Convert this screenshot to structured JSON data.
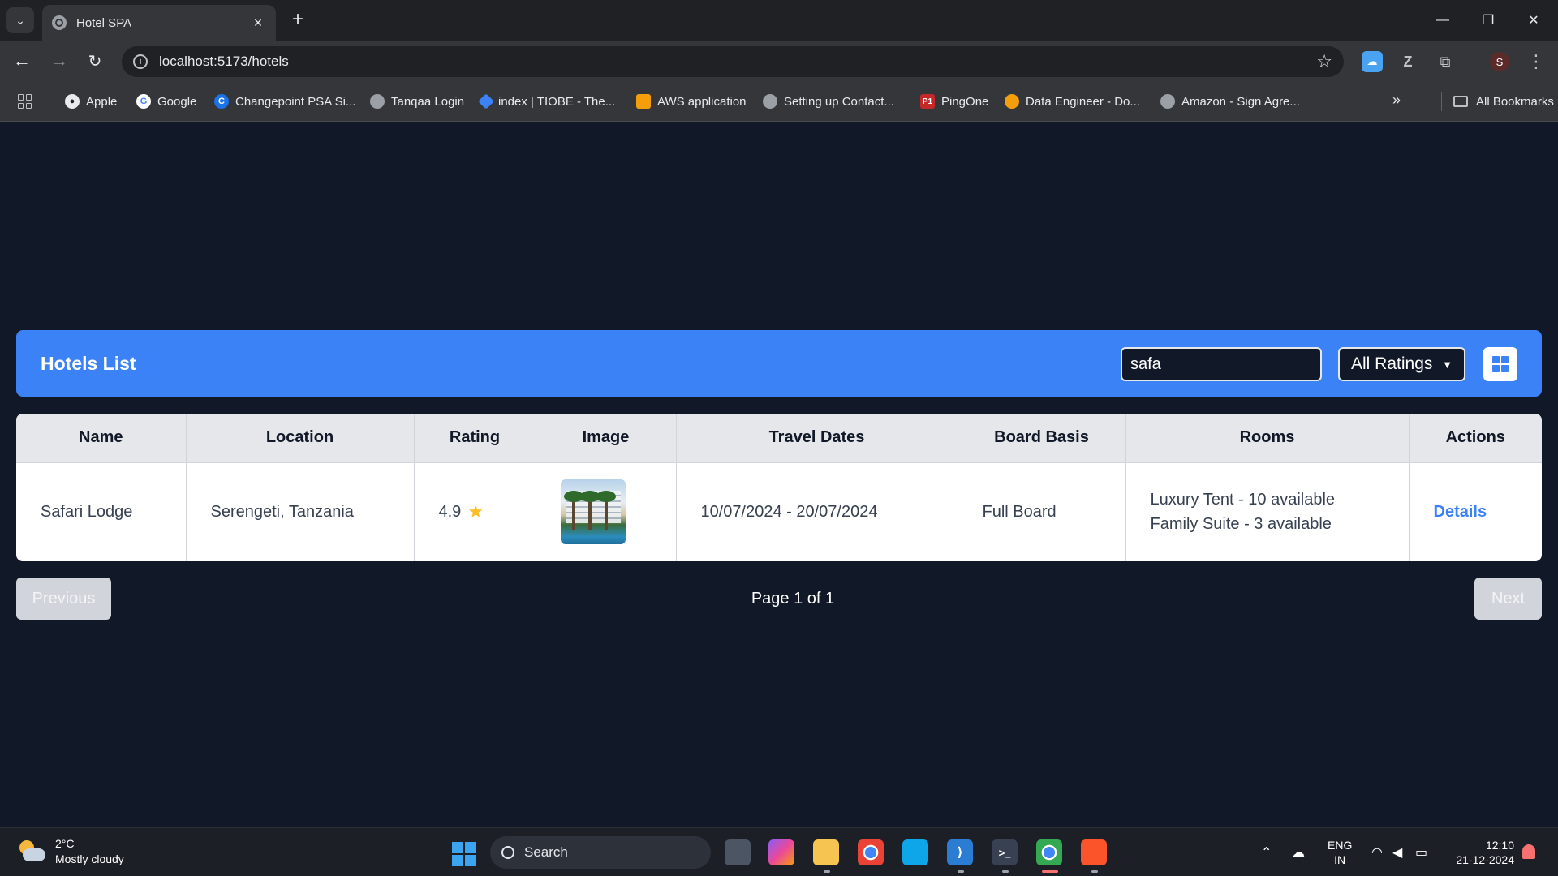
{
  "browser": {
    "tab_title": "Hotel SPA",
    "url": "localhost:5173/hotels",
    "profile_initial": "S",
    "bookmarks": [
      {
        "label": "Apple",
        "color": "#e8eaed"
      },
      {
        "label": "Google",
        "color": "#4285f4"
      },
      {
        "label": "Changepoint PSA Si...",
        "color": "#1a73e8"
      },
      {
        "label": "Tanqaa Login",
        "color": "#9aa0a6"
      },
      {
        "label": "index | TIOBE - The...",
        "color": "#3b82f6"
      },
      {
        "label": "AWS application",
        "color": "#f59e0b"
      },
      {
        "label": "Setting up Contact...",
        "color": "#9aa0a6"
      },
      {
        "label": "PingOne",
        "color": "#c62828"
      },
      {
        "label": "Data Engineer - Do...",
        "color": "#f59e0b"
      },
      {
        "label": "Amazon - Sign Agre...",
        "color": "#9aa0a6"
      }
    ],
    "all_bookmarks_label": "All Bookmarks"
  },
  "page": {
    "header_title": "Hotels List",
    "search_value": "safa",
    "rating_filter": "All Ratings",
    "table": {
      "columns": [
        "Name",
        "Location",
        "Rating",
        "Image",
        "Travel Dates",
        "Board Basis",
        "Rooms",
        "Actions"
      ],
      "rows": [
        {
          "name": "Safari Lodge",
          "location": "Serengeti, Tanzania",
          "rating": "4.9",
          "travel_dates": "10/07/2024 - 20/07/2024",
          "board_basis": "Full Board",
          "rooms": [
            "Luxury Tent - 10 available",
            "Family Suite - 3 available"
          ],
          "action": "Details"
        }
      ]
    },
    "pagination": {
      "previous": "Previous",
      "next": "Next",
      "info": "Page 1 of 1"
    }
  },
  "taskbar": {
    "weather_temp": "2°C",
    "weather_desc": "Mostly cloudy",
    "search_label": "Search",
    "lang_line1": "ENG",
    "lang_line2": "IN",
    "time": "12:10",
    "date": "21-12-2024"
  },
  "colors": {
    "page_bg": "#111827",
    "header_blue": "#3b82f6",
    "link_blue": "#3b82f6",
    "star_yellow": "#fbbf24"
  }
}
